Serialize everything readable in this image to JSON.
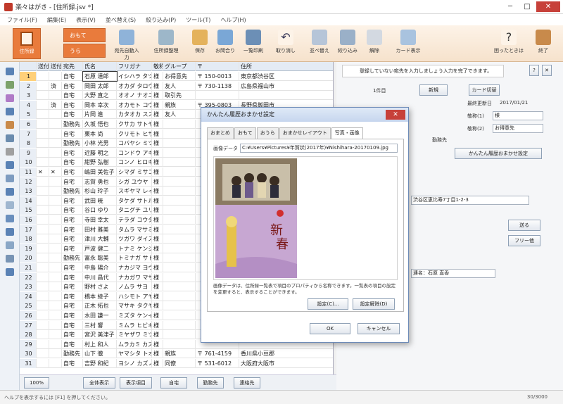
{
  "window": {
    "title": "楽々はがき - [住所録.jsv *]"
  },
  "menu": [
    "ファイル(F)",
    "編集(E)",
    "表示(V)",
    "並べ替え(S)",
    "絞り込み(P)",
    "ツール(T)",
    "ヘルプ(H)"
  ],
  "ribbon": {
    "main_label": "住所録",
    "omote": "おもて",
    "ura": "うら",
    "buttons": [
      "宛先自動入力",
      "住所録整理",
      "保存",
      "お問合り",
      "一覧印刷",
      "取り消し",
      "並べ替え",
      "絞り込み",
      "解除",
      "カード表示",
      "困ったときは",
      "終了"
    ]
  },
  "grid": {
    "headers": [
      "送付",
      "送付",
      "宛先",
      "氏名",
      "フリガナ",
      "敬称",
      "グループ",
      "〒",
      "住所"
    ],
    "rows": [
      [
        "1",
        "",
        "",
        "自宅",
        "石原 達郎",
        "イシハラ タツロウ",
        "様",
        "お得意先",
        "〒 150-0013",
        "東京都渋谷区"
      ],
      [
        "2",
        "",
        "済",
        "自宅",
        "岡田 太郎",
        "オカダ タロウ",
        "様",
        "友人",
        "〒 730-1138",
        "広島県福山市"
      ],
      [
        "3",
        "",
        "",
        "自宅",
        "大野 直之",
        "オオノ ナオユキ",
        "様",
        "取引先",
        "",
        ""
      ],
      [
        "4",
        "",
        "済",
        "自宅",
        "岡本 幸次",
        "オカモト コウジ",
        "様",
        "親族",
        "〒 395-0803",
        "長野県飯田市"
      ],
      [
        "5",
        "",
        "",
        "自宅",
        "片岡 進",
        "カタオカ ススム",
        "様",
        "友人",
        "",
        ""
      ],
      [
        "6",
        "",
        "",
        "勤務先",
        "久坂 悟也",
        "クサカ サトヤ",
        "様",
        "",
        "",
        ""
      ],
      [
        "7",
        "",
        "",
        "自宅",
        "栗本 尚",
        "クリモト ヒサシ",
        "様",
        "",
        "",
        ""
      ],
      [
        "8",
        "",
        "",
        "勤務先",
        "小林 光男",
        "コバヤシ ミツオ",
        "様",
        "",
        "",
        ""
      ],
      [
        "9",
        "",
        "",
        "自宅",
        "近藤 明之",
        "コンドウ アキユキ",
        "様",
        "",
        "",
        ""
      ],
      [
        "10",
        "",
        "",
        "自宅",
        "紺野 弘樹",
        "コンノ ヒロキ",
        "様",
        "",
        "",
        ""
      ],
      [
        "11",
        "✕",
        "✕",
        "自宅",
        "嶋田 美佐子",
        "シマダ ミサコ",
        "様",
        "",
        "",
        ""
      ],
      [
        "12",
        "",
        "",
        "自宅",
        "志賀 勇也",
        "シガ ユウヤ",
        "様",
        "",
        "",
        ""
      ],
      [
        "13",
        "",
        "",
        "勤務先",
        "杉山 玲子",
        "スギヤマ レイコ",
        "様",
        "",
        "",
        ""
      ],
      [
        "14",
        "",
        "",
        "自宅",
        "武田 暁",
        "タケダ サトル",
        "様",
        "",
        "",
        ""
      ],
      [
        "15",
        "",
        "",
        "自宅",
        "谷口 ゆり",
        "タニグチ ユリ",
        "様",
        "",
        "",
        ""
      ],
      [
        "16",
        "",
        "",
        "自宅",
        "寺田 幸太",
        "テラダ コウタ",
        "様",
        "",
        "",
        ""
      ],
      [
        "17",
        "",
        "",
        "自宅",
        "田村 雅美",
        "タムラ マサミ",
        "様",
        "",
        "",
        ""
      ],
      [
        "18",
        "",
        "",
        "自宅",
        "津川 大輔",
        "ツガワ ダイスケ",
        "様",
        "",
        "",
        ""
      ],
      [
        "19",
        "",
        "",
        "自宅",
        "戸波 健二",
        "トナミ ケンジ",
        "様",
        "",
        "",
        ""
      ],
      [
        "20",
        "",
        "",
        "勤務先",
        "富永 聡美",
        "トミナガ サトミ",
        "様",
        "",
        "",
        ""
      ],
      [
        "21",
        "",
        "",
        "自宅",
        "中島 陽介",
        "ナカジマ ヨウスケ",
        "様",
        "",
        "",
        ""
      ],
      [
        "22",
        "",
        "",
        "自宅",
        "中川 昌代",
        "ナカガワ マサヨ",
        "様",
        "",
        "",
        ""
      ],
      [
        "23",
        "",
        "",
        "自宅",
        "野村 さよ",
        "ノムラ サヨ",
        "様",
        "",
        "",
        ""
      ],
      [
        "24",
        "",
        "",
        "自宅",
        "橋本 綾子",
        "ハシモト アヤコ",
        "様",
        "",
        "",
        ""
      ],
      [
        "25",
        "",
        "",
        "自宅",
        "正木 拓也",
        "マサキ タクヤ",
        "様",
        "",
        "",
        ""
      ],
      [
        "26",
        "",
        "",
        "自宅",
        "水田 謙一",
        "ミズタ ケンイチ",
        "様",
        "",
        "",
        ""
      ],
      [
        "27",
        "",
        "",
        "自宅",
        "三村 響",
        "ミムラ ヒビキ",
        "様",
        "",
        "",
        ""
      ],
      [
        "28",
        "",
        "",
        "自宅",
        "宮沢 美津子",
        "ミヤザワ ミツコ",
        "様",
        "",
        "",
        ""
      ],
      [
        "29",
        "",
        "",
        "自宅",
        "村上 和人",
        "ムラカミ カズト",
        "様",
        "",
        "",
        ""
      ],
      [
        "30",
        "",
        "",
        "勤務先",
        "山下 徹",
        "ヤマシタ トオル",
        "様",
        "親族",
        "〒 761-4159",
        "香川県小豆郡"
      ],
      [
        "31",
        "",
        "",
        "自宅",
        "吉野 和紀",
        "ヨシノ カズノリ",
        "様",
        "同僚",
        "〒 531-6012",
        "大阪府大阪市"
      ]
    ]
  },
  "bottombar": [
    "100%",
    "全体表示",
    "表示項目",
    "自宅",
    "勤務先",
    "連絡先"
  ],
  "status": {
    "help": "ヘルプを表示するには [F1] を押してください。",
    "count": "30/3000"
  },
  "right": {
    "hint": "登録していない宛先を入力しましょう入力を完了できます。",
    "page": "1件目",
    "btn_new": "新規",
    "btn_card": "カード切替",
    "updated_label": "最終更新日",
    "updated_value": "2017/01/21",
    "keisho1_label": "敬称(1)",
    "keisho1_value": "様",
    "keisho2_label": "敬称(2)",
    "keisho2_value": "お得意先",
    "address": "渋谷区恵比寿7丁目1-2-3",
    "easy_setting": "かんたん履歴おまかせ設定",
    "radio_label": "勤務先",
    "send_btn": "送る",
    "other_btn": "フリー他",
    "joint_name": "連名：石原 直香"
  },
  "dialog": {
    "title": "かんたん履歴おまかせ設定",
    "tabs": [
      "おまとめ",
      "おもて",
      "おうら",
      "おまかせレイアウト",
      "写真・画像"
    ],
    "path_label": "画像データ",
    "path_value": "C:¥Users¥Pictures¥年賀状(2017年)¥Nishihara-20170109.jpg",
    "caption_1": "新",
    "caption_2": "春",
    "note": "画像データは、住所録一覧表で項目のプロパティから名称できます。一覧表の項目の設定を変更すると、表示することができます。",
    "set_btn": "設定(C)...",
    "clear_btn": "設定解除(D)",
    "ok": "OK",
    "cancel": "キャンセル"
  },
  "colors": {
    "accent": "#e97b3c",
    "header": "#e4ebf4",
    "selected": "#ffd079"
  }
}
